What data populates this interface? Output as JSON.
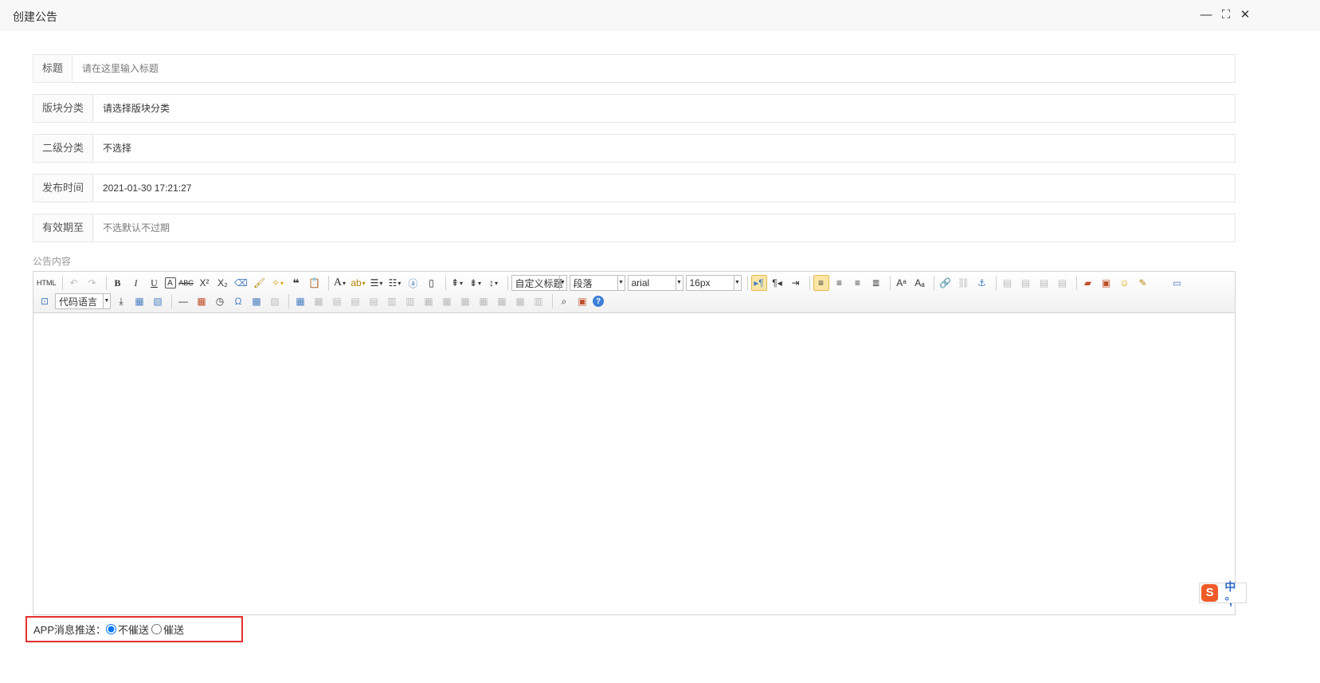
{
  "window": {
    "title": "创建公告",
    "minimize_symbol": "—",
    "maximize_symbol": "⛶",
    "close_symbol": "✕"
  },
  "form": {
    "title_label": "标题",
    "title_placeholder": "请在这里输入标题",
    "category_label": "版块分类",
    "category_value": "请选择版块分类",
    "subcategory_label": "二级分类",
    "subcategory_value": "不选择",
    "publish_time_label": "发布时间",
    "publish_time_value": "2021-01-30 17:21:27",
    "expiry_label": "有效期至",
    "expiry_placeholder": "不选默认不过期"
  },
  "content_label": "公告内容",
  "editor": {
    "toolbar": {
      "custom_heading": "自定义标题",
      "paragraph": "段落",
      "font_family": "arial",
      "font_size": "16px",
      "code_language": "代码语言"
    }
  },
  "ime": {
    "logo": "S",
    "text": "中 °,"
  },
  "push": {
    "label": "APP消息推送：",
    "option_no": "不催送",
    "option_yes": "催送",
    "selected": "不催送"
  },
  "colors": {
    "highlight_border": "#e53030",
    "toolbar_active": "#fbe6a6",
    "ime_orange": "#ef5a28",
    "ime_blue": "#2c68c8"
  }
}
